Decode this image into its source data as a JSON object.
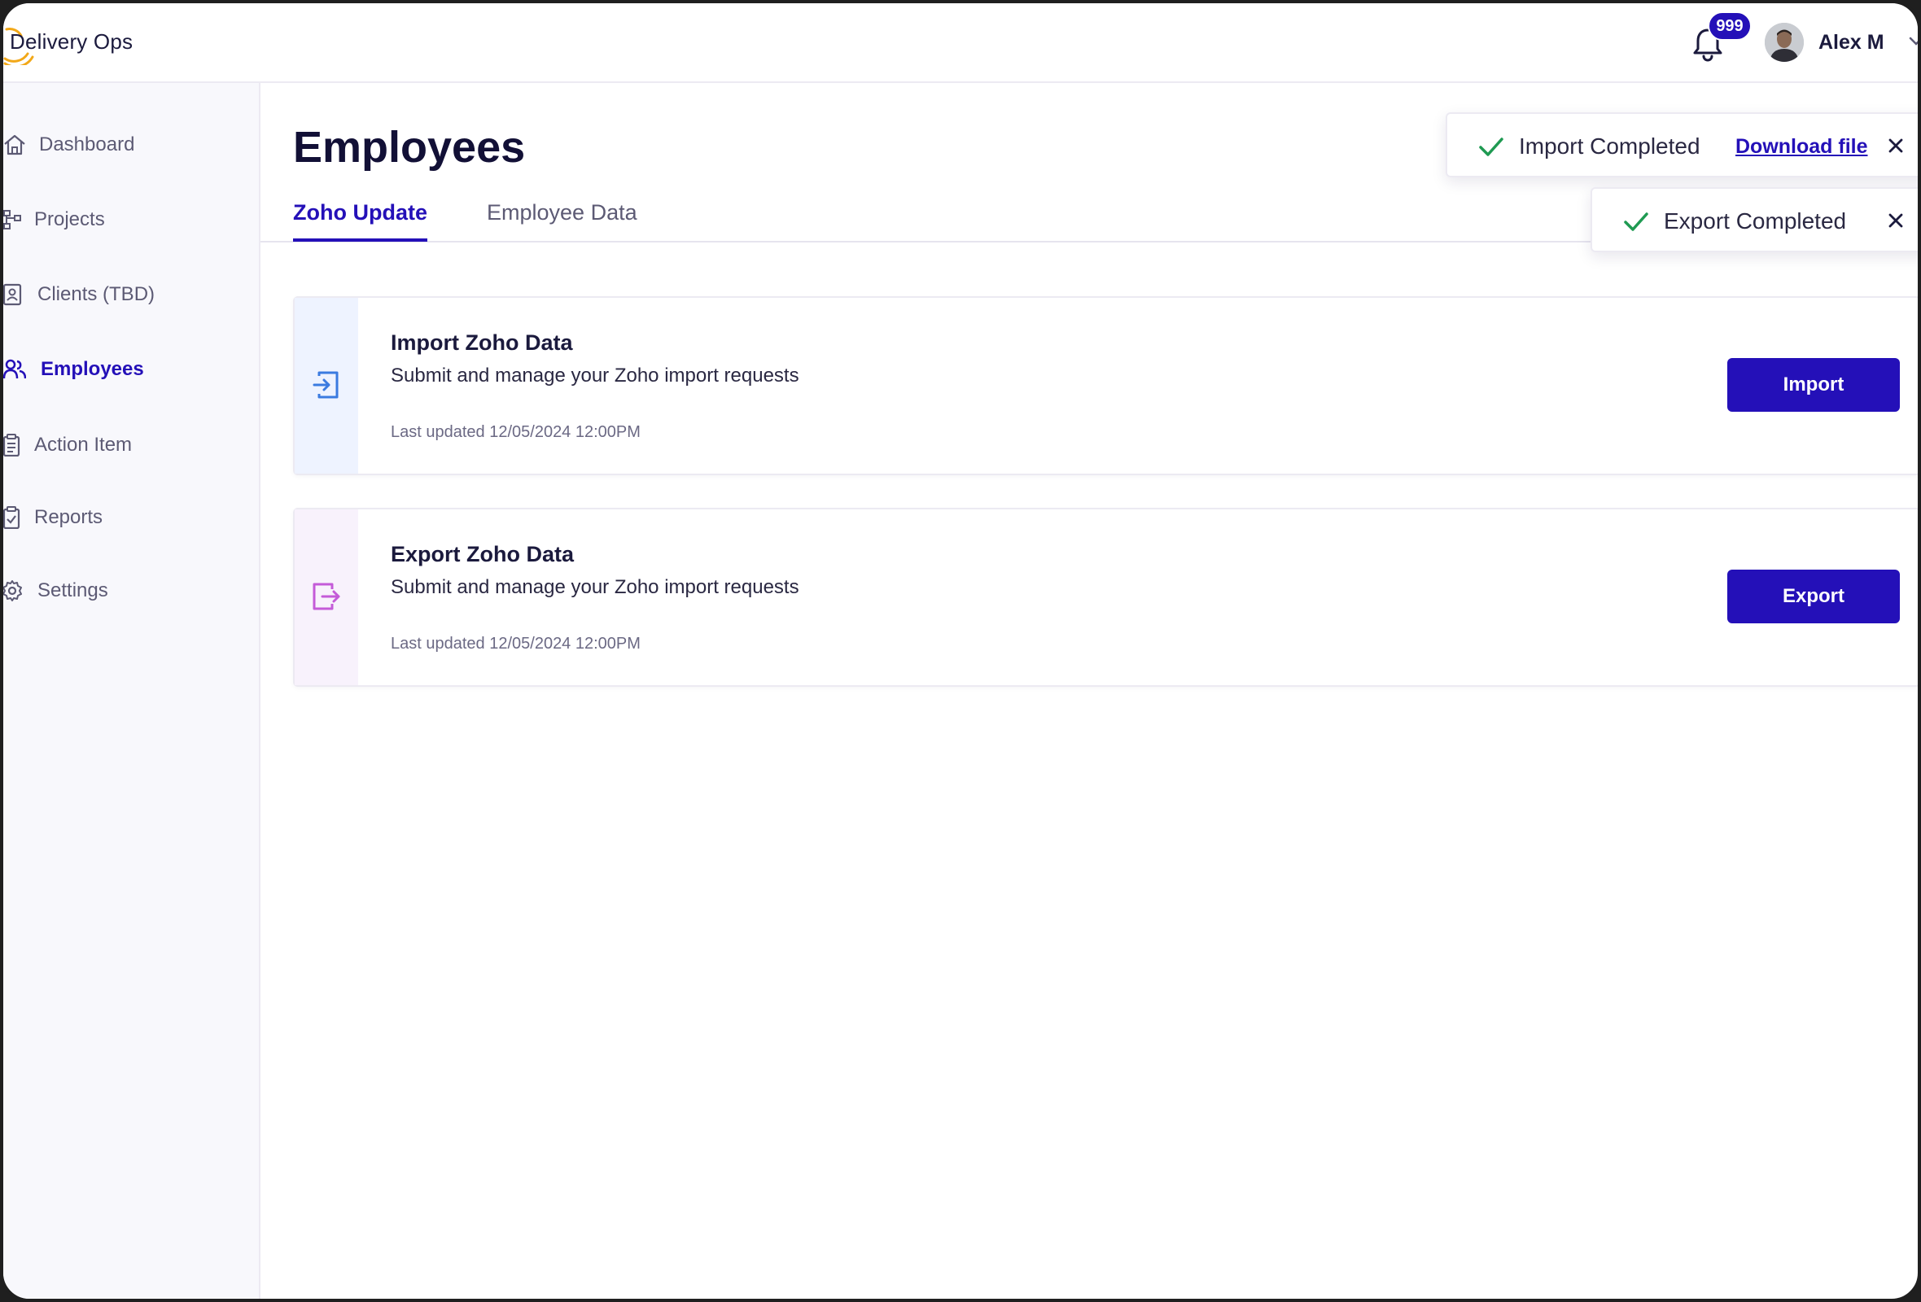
{
  "app": {
    "logo_text": "Delivery Ops"
  },
  "header": {
    "notification_count": "999",
    "user_name": "Alex M"
  },
  "sidebar": {
    "items": [
      {
        "label": "Dashboard",
        "icon": "home-icon"
      },
      {
        "label": "Projects",
        "icon": "hierarchy-icon"
      },
      {
        "label": "Clients (TBD)",
        "icon": "contact-card-icon"
      },
      {
        "label": "Employees",
        "icon": "users-icon",
        "active": true
      },
      {
        "label": "Action Item",
        "icon": "clipboard-icon"
      },
      {
        "label": "Reports",
        "icon": "clipboard-check-icon"
      },
      {
        "label": "Settings",
        "icon": "gear-icon"
      }
    ]
  },
  "main": {
    "title": "Employees",
    "tabs": [
      {
        "label": "Zoho Update",
        "active": true
      },
      {
        "label": "Employee Data",
        "active": false
      }
    ],
    "cards": [
      {
        "title": "Import Zoho Data",
        "description": "Submit and manage your Zoho import requests",
        "meta": "Last updated 12/05/2024 12:00PM",
        "button": "Import",
        "icon": "import-icon"
      },
      {
        "title": "Export Zoho Data",
        "description": "Submit and manage your Zoho import requests",
        "meta": "Last updated 12/05/2024 12:00PM",
        "button": "Export",
        "icon": "export-icon"
      }
    ]
  },
  "toasts": [
    {
      "text": "Import Completed",
      "link": "Download file"
    },
    {
      "text": "Export Completed"
    }
  ],
  "colors": {
    "accent": "#2410b8",
    "success": "#1f9a52",
    "import_strip": "#eef3ff",
    "export_strip": "#f8f2fc",
    "import_icon": "#3b7be0",
    "export_icon": "#c45bd8"
  }
}
